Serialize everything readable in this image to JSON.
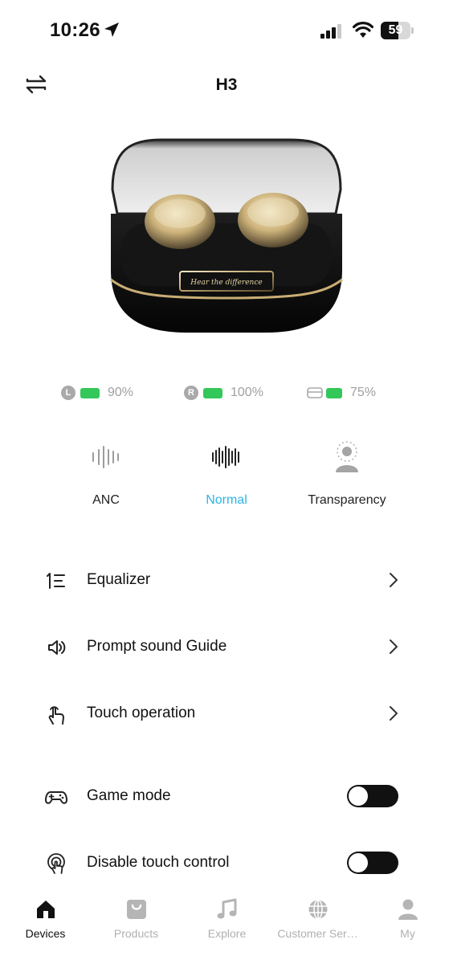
{
  "status_bar": {
    "time": "10:26",
    "battery_level": "59",
    "battery_fraction": 0.59,
    "icons": [
      "location-arrow-icon",
      "cellular-signal-icon",
      "wifi-icon",
      "battery-icon"
    ]
  },
  "header": {
    "title": "H3",
    "left_icon": "switch-device-icon"
  },
  "product": {
    "case_engraving": "Hear the difference"
  },
  "battery": {
    "left_badge": "L",
    "left_pct": "90%",
    "right_badge": "R",
    "right_pct": "100%",
    "case_pct": "75%",
    "indicator_color": "#34c759"
  },
  "modes": {
    "items": [
      {
        "label": "ANC",
        "icon": "anc-wave-icon",
        "active": false
      },
      {
        "label": "Normal",
        "icon": "normal-wave-icon",
        "active": true
      },
      {
        "label": "Transparency",
        "icon": "transparency-person-icon",
        "active": false
      }
    ],
    "active_color": "#2bb5e6"
  },
  "menu": {
    "equalizer": "Equalizer",
    "prompt_sound": "Prompt sound Guide",
    "touch_operation": "Touch operation",
    "game_mode": "Game mode",
    "disable_touch": "Disable touch control",
    "game_mode_on": false,
    "disable_touch_on": false
  },
  "tabs": {
    "devices": "Devices",
    "products": "Products",
    "explore": "Explore",
    "customer_service": "Customer Ser…",
    "my": "My",
    "active": "Devices"
  }
}
